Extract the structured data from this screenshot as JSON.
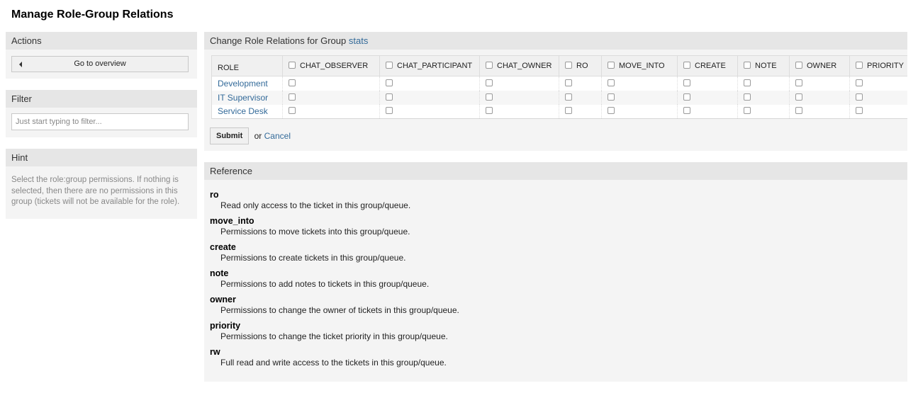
{
  "page": {
    "title": "Manage Role-Group Relations"
  },
  "sidebar": {
    "actions": {
      "header": "Actions",
      "go_to_overview_label": "Go to overview",
      "icon": "caret-left-icon"
    },
    "filter": {
      "header": "Filter",
      "placeholder": "Just start typing to filter...",
      "value": ""
    },
    "hint": {
      "header": "Hint",
      "text": "Select the role:group permissions. If nothing is selected, then there are no permissions in this group (tickets will not be available for the role)."
    }
  },
  "relations": {
    "header_prefix": "Change Role Relations for Group",
    "group_name": "stats",
    "role_column_label": "ROLE",
    "permission_columns": [
      {
        "key": "chat_observer",
        "label": "CHAT_OBSERVER",
        "checked": false
      },
      {
        "key": "chat_participant",
        "label": "CHAT_PARTICIPANT",
        "checked": false
      },
      {
        "key": "chat_owner",
        "label": "CHAT_OWNER",
        "checked": false
      },
      {
        "key": "ro",
        "label": "RO",
        "checked": false
      },
      {
        "key": "move_into",
        "label": "MOVE_INTO",
        "checked": false
      },
      {
        "key": "create",
        "label": "CREATE",
        "checked": false
      },
      {
        "key": "note",
        "label": "NOTE",
        "checked": false
      },
      {
        "key": "owner",
        "label": "OWNER",
        "checked": false
      },
      {
        "key": "priority",
        "label": "PRIORITY",
        "checked": false
      }
    ],
    "rows": [
      {
        "role": "Development",
        "checked": [
          false,
          false,
          false,
          false,
          false,
          false,
          false,
          false,
          false
        ]
      },
      {
        "role": "IT Supervisor",
        "checked": [
          false,
          false,
          false,
          false,
          false,
          false,
          false,
          false,
          false
        ]
      },
      {
        "role": "Service Desk",
        "checked": [
          false,
          false,
          false,
          false,
          false,
          false,
          false,
          false,
          false
        ]
      }
    ],
    "submit_label": "Submit",
    "or_text": "or",
    "cancel_label": "Cancel"
  },
  "reference": {
    "header": "Reference",
    "items": [
      {
        "term": "ro",
        "description": "Read only access to the ticket in this group/queue."
      },
      {
        "term": "move_into",
        "description": "Permissions to move tickets into this group/queue."
      },
      {
        "term": "create",
        "description": "Permissions to create tickets in this group/queue."
      },
      {
        "term": "note",
        "description": "Permissions to add notes to tickets in this group/queue."
      },
      {
        "term": "owner",
        "description": "Permissions to change the owner of tickets in this group/queue."
      },
      {
        "term": "priority",
        "description": "Permissions to change the ticket priority in this group/queue."
      },
      {
        "term": "rw",
        "description": "Full read and write access to the tickets in this group/queue."
      }
    ]
  },
  "colors": {
    "link": "#336a99",
    "widget_bg": "#f4f4f4",
    "widget_header_bg": "#e6e6e6",
    "hint_text": "#888888"
  }
}
